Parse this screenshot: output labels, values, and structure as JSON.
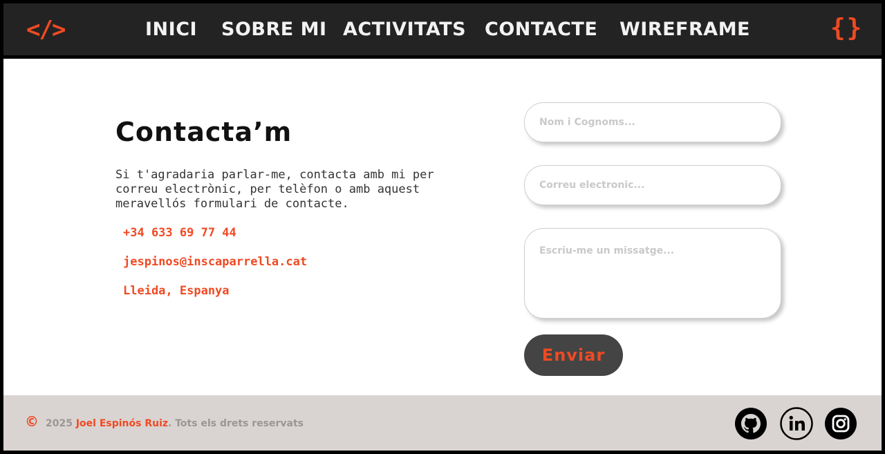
{
  "header": {
    "logo_left": "</>",
    "logo_right": "{}",
    "nav": [
      "INICI",
      "SOBRE MI",
      "ACTIVITATS",
      "CONTACTE",
      "WIREFRAME"
    ]
  },
  "contact": {
    "title": "Contacta’m",
    "intro": "Si t'agradaria parlar-me, contacta amb mi per correu electrònic, per telèfon o amb aquest meravellós formulari de contacte.",
    "phone": "+34 633 69 77 44",
    "email": "jespinos@inscaparrella.cat",
    "location": "Lleida, Espanya"
  },
  "form": {
    "name_placeholder": "Nom i Cognoms...",
    "email_placeholder": "Correu electronic...",
    "message_placeholder": "Escriu-me un missatge...",
    "submit_label": "Enviar"
  },
  "footer": {
    "copyright_symbol": "©",
    "year": "2025",
    "author": "Joel Espinós Ruiz",
    "rights": ". Tots els drets reservats",
    "social_icons": [
      "github-icon",
      "linkedin-icon",
      "instagram-icon"
    ]
  },
  "colors": {
    "accent": "#ef4a23",
    "header_bg": "#232323",
    "footer_bg": "#d9d4d2",
    "button_bg": "#444444"
  }
}
